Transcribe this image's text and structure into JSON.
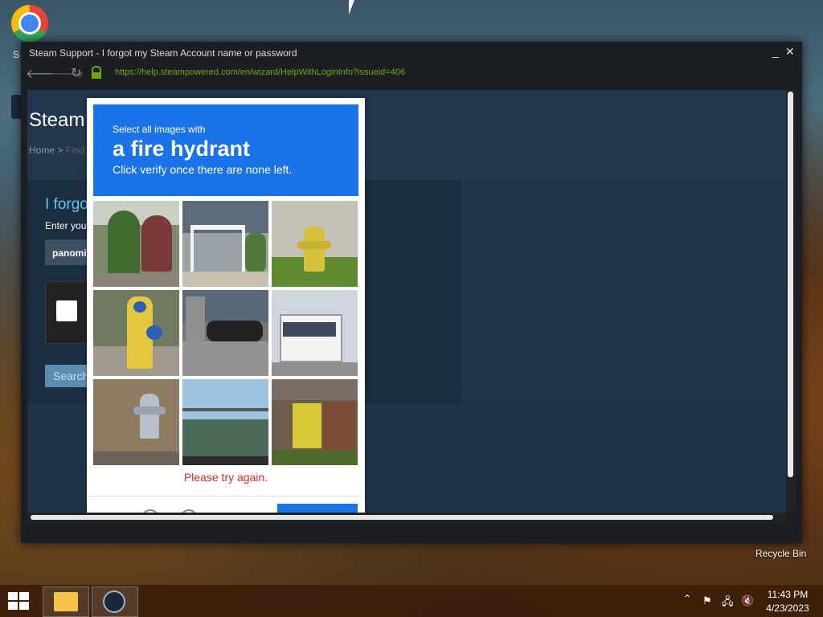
{
  "desktop": {
    "chrome_label": "S",
    "steam_label": "S",
    "recycle_bin_label": "Recycle Bin"
  },
  "window": {
    "title": "Steam Support - I forgot my Steam Account name or password",
    "minimize": "_",
    "close": "✕",
    "url": "https://help.steampowered.com/en/wizard/HelpWithLoginInfo?issueid=406"
  },
  "page": {
    "brand": "Steam",
    "breadcrumb_home": "Home",
    "breadcrumb_sep": " > ",
    "breadcrumb_current": "Find",
    "heading": "I forgo",
    "prompt": "Enter you",
    "account_value": "panomi",
    "search_label": "Search"
  },
  "captcha": {
    "instruction_line1": "Select all images with",
    "target": "a fire hydrant",
    "instruction_line3": "Click verify once there are none left.",
    "error_message": "Please try again.",
    "tiles": [
      "garden-plants",
      "porch-railing",
      "yellow-fire-hydrant",
      "yellow-blue-fire-hydrant",
      "parked-motorcycles",
      "white-bus",
      "gray-fire-hydrant",
      "construction-scaffold",
      "yellow-shed"
    ]
  },
  "taskbar": {
    "time": "11:43 PM",
    "date": "4/23/2023",
    "tray_chevron": "⌃"
  }
}
